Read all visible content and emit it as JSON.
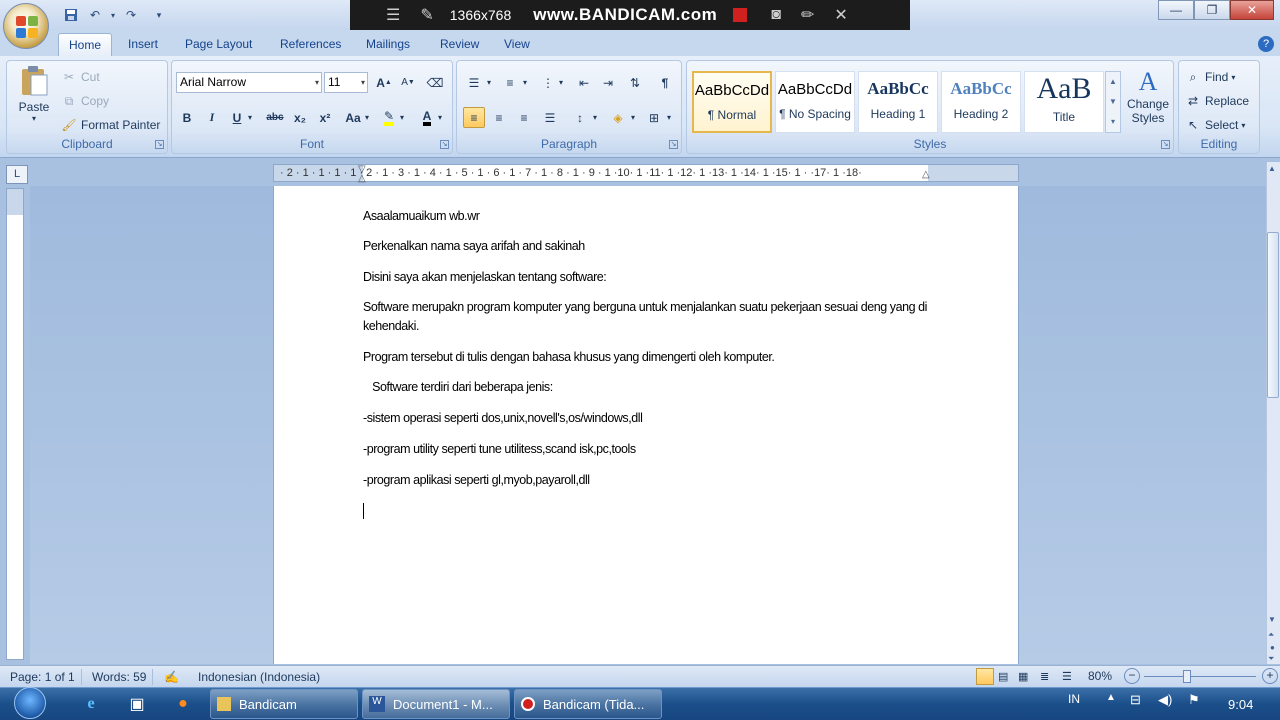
{
  "window": {
    "title_tabs": [
      "Home",
      "Insert",
      "Page Layout",
      "References",
      "Mailings",
      "Review",
      "View"
    ]
  },
  "bandicam": {
    "resolution": "1366x768",
    "watermark": "www.BANDICAM.com"
  },
  "qat": {
    "save_icon": "save-icon",
    "undo_icon": "undo-icon",
    "redo_icon": "redo-icon"
  },
  "ribbon": {
    "clipboard": {
      "label": "Clipboard",
      "paste": "Paste",
      "cut": "Cut",
      "copy": "Copy",
      "format_painter": "Format Painter"
    },
    "font": {
      "label": "Font",
      "font_name": "Arial Narrow",
      "font_size": "11",
      "bold": "B",
      "italic": "I",
      "underline": "U",
      "strike": "abc",
      "sub": "x₂",
      "sup": "x²",
      "case": "Aa",
      "grow": "A",
      "shrink": "A"
    },
    "paragraph": {
      "label": "Paragraph",
      "pilcrow": "¶"
    },
    "styles": {
      "label": "Styles",
      "tiles": [
        {
          "sample": "AaBbCcDd",
          "name": "¶ Normal"
        },
        {
          "sample": "AaBbCcDd",
          "name": "¶ No Spacing"
        },
        {
          "sample": "AaBbCc",
          "name": "Heading 1"
        },
        {
          "sample": "AaBbCc",
          "name": "Heading 2"
        },
        {
          "sample": "AaB",
          "name": "Title"
        }
      ],
      "change_styles_1": "Change",
      "change_styles_2": "Styles"
    },
    "editing": {
      "label": "Editing",
      "find": "Find",
      "replace": "Replace",
      "select": "Select"
    }
  },
  "ruler": {
    "ticks": "· 2 · 1 · 1 · 1 · 1 · 2 · 1 · 3 · 1 · 4 · 1 · 5 · 1 · 6 · 1 · 7 · 1 · 8 · 1 · 9 · 1 ·10· 1 ·11· 1 ·12· 1 ·13· 1 ·14· 1 ·15· 1 ·    ·17· 1 ·18·"
  },
  "document": {
    "paragraphs": [
      "Asaalamuaikum wb.wr",
      " Perkenalkan nama saya arifah and sakinah",
      "Disini saya akan menjelaskan tentang software:",
      "Software merupakn program komputer yang berguna untuk menjalankan suatu pekerjaan sesuai deng yang di",
      "kehendaki.",
      "Program tersebut di tulis dengan bahasa khusus yang dimengerti oleh komputer.",
      "   Software terdiri dari beberapa jenis:",
      "-sistem operasi seperti dos,unix,novell's,os/windows,dll",
      "-program utility seperti tune utilitess,scand isk,pc,tools",
      "-program aplikasi seperti gl,myob,payaroll,dll"
    ]
  },
  "statusbar": {
    "page": "Page: 1 of 1",
    "words": "Words: 59",
    "language": "Indonesian (Indonesia)",
    "zoom": "80%"
  },
  "taskbar": {
    "buttons": [
      "Bandicam",
      "Document1 - M...",
      "Bandicam (Tida..."
    ],
    "lang": "IN",
    "time": "9:04"
  },
  "colors": {
    "ribbon_bg": "#dbe6f5",
    "accent": "#15428b",
    "taskbar": "#1b4f8a"
  }
}
